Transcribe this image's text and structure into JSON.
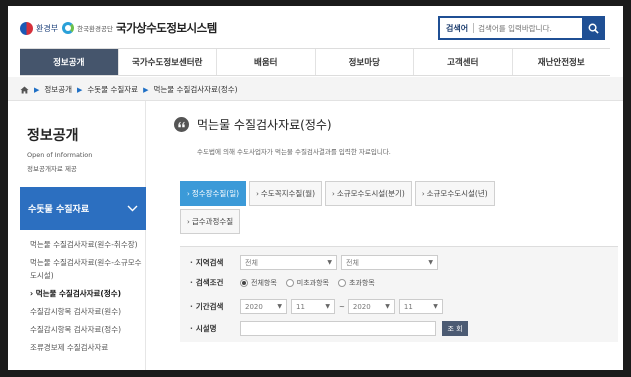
{
  "header": {
    "ministry": "환경부",
    "agency": "한국환경공단",
    "site_title": "국가상수도정보시스템",
    "search_label": "검색어",
    "search_placeholder": "검색어를 입력바랍니다."
  },
  "gnb": [
    "정보공개",
    "국가수도정보센터란",
    "배움터",
    "정보마당",
    "고객센터",
    "재난안전정보"
  ],
  "breadcrumb": [
    "정보공개",
    "수돗물 수질자료",
    "먹는물 수질검사자료(정수)"
  ],
  "sidebar": {
    "title": "정보공개",
    "subtitle_en": "Open of Information",
    "subtitle_kr": "정보공개자료 제공",
    "group_label": "수돗물 수질자료",
    "items": [
      "먹는물 수질검사자료(원수-취수장)",
      "먹는물 수질검사자료(원수-소규모수도시설)",
      "› 먹는물 수질검사자료(정수)",
      "수질감시항목 검사자료(원수)",
      "수질감시항목 검사자료(정수)",
      "조류경보제 수질검사자료"
    ]
  },
  "content": {
    "title": "먹는물 수질검사자료(정수)",
    "description": "수도법에 의해 수도사업자가 먹는물 수질검사결과를 입력한 자료입니다.",
    "tabs": [
      "정수장수질(일)",
      "수도꼭지수질(월)",
      "소규모수도시설(분기)",
      "소규모수도시설(년)",
      "급수과정수질"
    ],
    "form": {
      "region_label": "지역검색",
      "region_select_1": "전체",
      "region_select_2": "전체",
      "condition_label": "검색조건",
      "condition_options": [
        "전체항목",
        "미초과항목",
        "초과항목"
      ],
      "period_label": "기간검색",
      "start_year": "2020",
      "start_month": "11",
      "end_year": "2020",
      "end_month": "11",
      "tilde": "~",
      "facility_label": "시설명",
      "submit_label": "조 회"
    }
  },
  "colors": {
    "nav_active": "#45556c",
    "sidebar_group": "#2c6fc0",
    "tab_active": "#3b9ad8",
    "search_border": "#1f4f94"
  }
}
